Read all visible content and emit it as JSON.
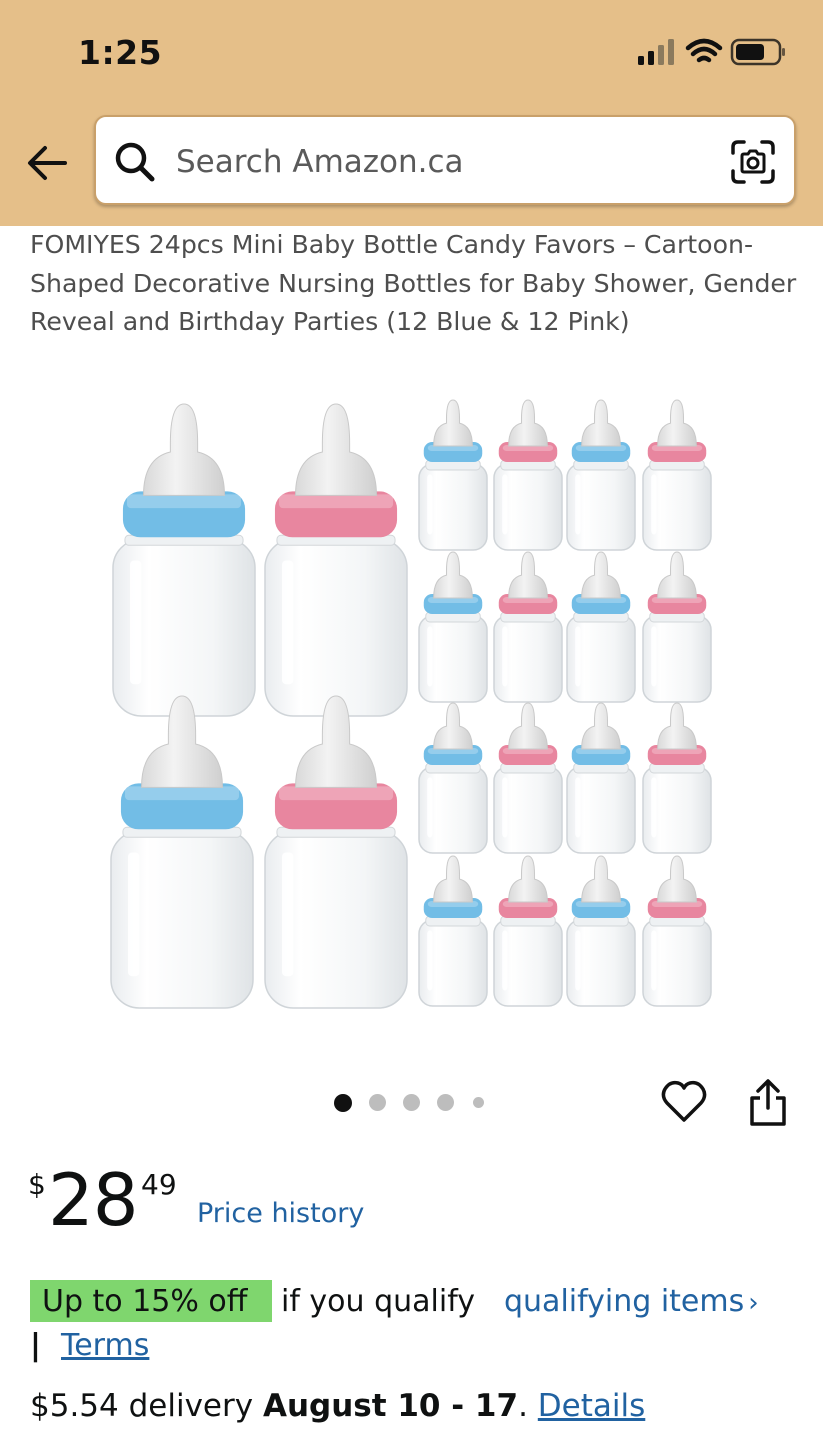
{
  "status_bar": {
    "time": "1:25",
    "icons": [
      "cellular-signal-icon",
      "wifi-icon",
      "battery-icon"
    ]
  },
  "header": {
    "background": "#e5bf89",
    "back_icon": "back-arrow-icon",
    "search": {
      "placeholder": "Search Amazon.ca",
      "value": "",
      "left_icon": "search-icon",
      "right_icon": "camera-search-icon"
    }
  },
  "product": {
    "title": "FOMIYES 24pcs Mini Baby Bottle Candy Favors – Cartoon-Shaped Decorative Nursing Bottles for Baby Shower, Gender Reveal and Birthday Parties (12 Blue & 12 Pink)",
    "image": {
      "subject": "product-photo",
      "cap_colors": {
        "blue": "#72bde6",
        "pink": "#e8869f"
      }
    },
    "carousel": {
      "total_dots": 5,
      "active_index": 0
    },
    "actions": {
      "wishlist_icon": "heart-icon",
      "share_icon": "share-icon"
    }
  },
  "price": {
    "symbol": "$",
    "whole": "28",
    "fraction": "49",
    "history_link": "Price history"
  },
  "promo": {
    "badge": "Up to 15% off",
    "qualify_text": "if you qualify",
    "link": "qualifying items",
    "separator": "|",
    "terms": "Terms",
    "badge_color": "#7fd66e",
    "link_color": "#2162a1"
  },
  "delivery": {
    "price": "$5.54 delivery",
    "dates": "August 10 - 17",
    "punct": ".",
    "details_link": "Details"
  }
}
